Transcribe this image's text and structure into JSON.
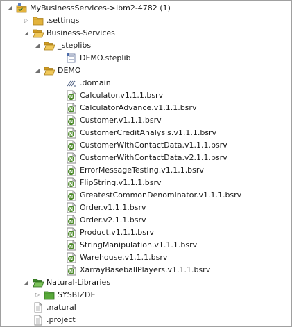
{
  "tree": [
    {
      "label": "MyBusinessServices->ibm2-4782 (1)",
      "level": 0,
      "state": "expanded",
      "icon": "project-icon"
    },
    {
      "label": ".settings",
      "level": 1,
      "state": "collapsed",
      "icon": "folder-icon"
    },
    {
      "label": "Business-Services",
      "level": 1,
      "state": "expanded",
      "icon": "folder-open-icon"
    },
    {
      "label": "_steplibs",
      "level": 2,
      "state": "expanded",
      "icon": "folder-open-icon"
    },
    {
      "label": "DEMO.steplib",
      "level": 3,
      "state": "none",
      "icon": "steplib-icon"
    },
    {
      "label": "DEMO",
      "level": 2,
      "state": "expanded",
      "icon": "folder-open-icon"
    },
    {
      "label": ".domain",
      "level": 3,
      "state": "none",
      "icon": "domain-icon"
    },
    {
      "label": "Calculator.v1.1.1.bsrv",
      "level": 3,
      "state": "none",
      "icon": "natural-file-icon"
    },
    {
      "label": "CalculatorAdvance.v1.1.1.bsrv",
      "level": 3,
      "state": "none",
      "icon": "natural-file-icon"
    },
    {
      "label": "Customer.v1.1.1.bsrv",
      "level": 3,
      "state": "none",
      "icon": "natural-file-icon"
    },
    {
      "label": "CustomerCreditAnalysis.v1.1.1.bsrv",
      "level": 3,
      "state": "none",
      "icon": "natural-file-icon"
    },
    {
      "label": "CustomerWithContactData.v1.1.1.bsrv",
      "level": 3,
      "state": "none",
      "icon": "natural-file-icon"
    },
    {
      "label": "CustomerWithContactData.v2.1.1.bsrv",
      "level": 3,
      "state": "none",
      "icon": "natural-file-icon"
    },
    {
      "label": "ErrorMessageTesting.v1.1.1.bsrv",
      "level": 3,
      "state": "none",
      "icon": "natural-file-icon"
    },
    {
      "label": "FlipString.v1.1.1.bsrv",
      "level": 3,
      "state": "none",
      "icon": "natural-file-icon"
    },
    {
      "label": "GreatestCommonDenominator.v1.1.1.bsrv",
      "level": 3,
      "state": "none",
      "icon": "natural-file-icon"
    },
    {
      "label": "Order.v1.1.1.bsrv",
      "level": 3,
      "state": "none",
      "icon": "natural-file-icon"
    },
    {
      "label": "Order.v2.1.1.bsrv",
      "level": 3,
      "state": "none",
      "icon": "natural-file-icon"
    },
    {
      "label": "Product.v1.1.1.bsrv",
      "level": 3,
      "state": "none",
      "icon": "natural-file-icon"
    },
    {
      "label": "StringManipulation.v1.1.1.bsrv",
      "level": 3,
      "state": "none",
      "icon": "natural-file-icon"
    },
    {
      "label": "Warehouse.v1.1.1.bsrv",
      "level": 3,
      "state": "none",
      "icon": "natural-file-icon"
    },
    {
      "label": "XarrayBaseballPlayers.v1.1.1.bsrv",
      "level": 3,
      "state": "none",
      "icon": "natural-file-icon"
    },
    {
      "label": "Natural-Libraries",
      "level": 1,
      "state": "expanded",
      "icon": "folder-green-icon"
    },
    {
      "label": "SYSBIZDE",
      "level": 2,
      "state": "collapsed",
      "icon": "library-icon"
    },
    {
      "label": ".natural",
      "level": 1,
      "state": "none",
      "icon": "text-file-icon"
    },
    {
      "label": ".project",
      "level": 1,
      "state": "none",
      "icon": "text-file-icon"
    }
  ],
  "colors": {
    "folder": "#e3b33c",
    "natural_badge": "#4c8a2a",
    "library_green": "#58a83a",
    "border": "#a0a0a0"
  }
}
